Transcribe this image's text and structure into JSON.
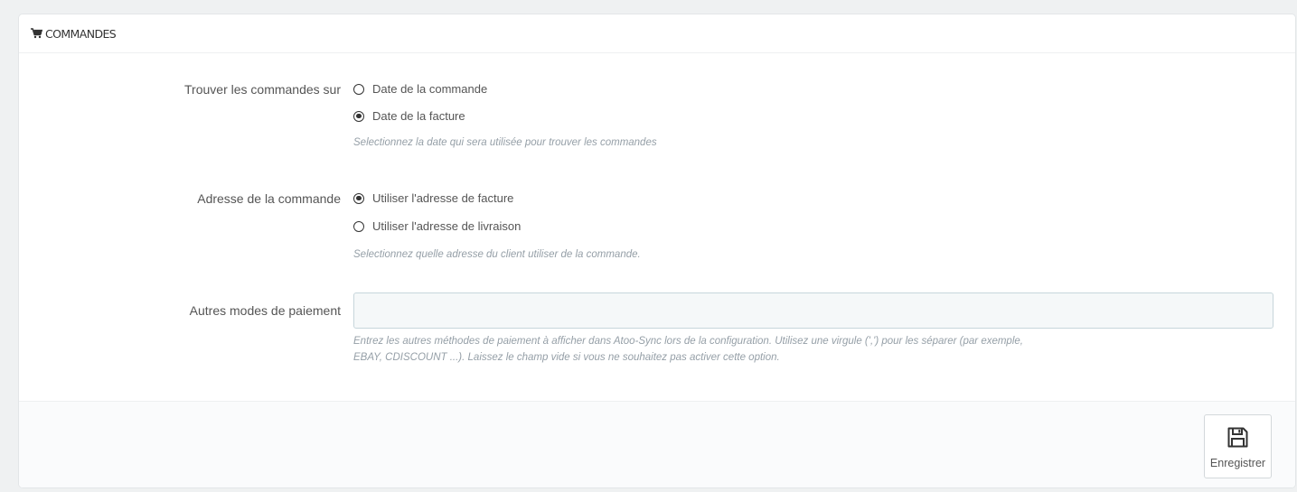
{
  "panel": {
    "title": "COMMANDES",
    "icon": "shopping-cart-icon"
  },
  "find_orders": {
    "label": "Trouver les commandes sur",
    "options": [
      {
        "label": "Date de la commande",
        "checked": false
      },
      {
        "label": "Date de la facture",
        "checked": true
      }
    ],
    "help": "Selectionnez la date qui sera utilisée pour trouver les commandes"
  },
  "order_address": {
    "label": "Adresse de la commande",
    "options": [
      {
        "label": "Utiliser l'adresse de facture",
        "checked": true
      },
      {
        "label": "Utiliser l'adresse de livraison",
        "checked": false
      }
    ],
    "help": "Selectionnez quelle adresse du client utiliser de la commande."
  },
  "payment_modes": {
    "label": "Autres modes de paiement",
    "value": "",
    "placeholder": "",
    "help_line1": "Entrez les autres méthodes de paiement à afficher dans Atoo-Sync lors de la configuration. Utilisez une virgule (',') pour les séparer (par exemple,",
    "help_line2": "EBAY, CDISCOUNT ...). Laissez le champ vide si vous ne souhaitez pas activer cette option."
  },
  "footer": {
    "save_label": "Enregistrer",
    "save_icon": "floppy-disk-icon"
  }
}
